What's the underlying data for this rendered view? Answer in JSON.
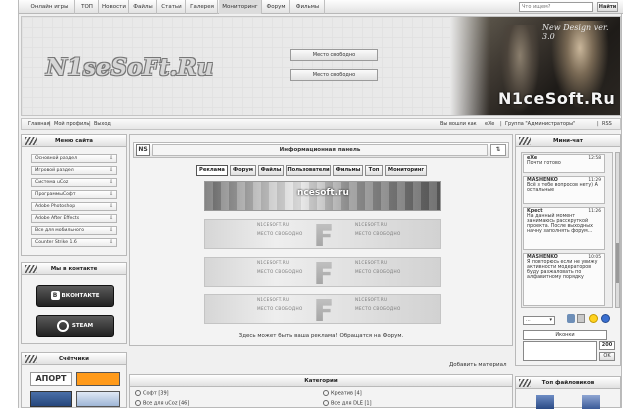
{
  "topnav": {
    "items": [
      "Онлайн игры",
      "ТОП",
      "Новости",
      "Файлы",
      "Статьи",
      "Галерея",
      "Мониторинг",
      "Форум",
      "Фильмы"
    ],
    "search_placeholder": "Что ищем?",
    "search_button": "Найти"
  },
  "header": {
    "logo": "N1seSoFt.Ru",
    "version": "New Design ver. 3.0",
    "brand": "N1ceSoft.Ru",
    "ads": [
      "Место свободно",
      "Место свободно"
    ]
  },
  "subbar": {
    "links": [
      "Главная",
      "Мой профиль",
      "Выход"
    ],
    "logged_in": "Вы вошли как",
    "user": "eXe",
    "group": "Группа \"Администраторы\"",
    "rss": "RSS"
  },
  "site_menu": {
    "title": "Меню сайта",
    "items": [
      "Основной раздел",
      "Игровой раздел",
      "Система uCoz",
      "ПрограммыСофт",
      "Adobe Photoshop",
      "Adobe After Effects",
      "Все для мобильного",
      "Counter Strike 1.6"
    ]
  },
  "social": {
    "title": "Мы в контакте",
    "vk": "ВКОНТАКТЕ",
    "steam": "STEAM"
  },
  "counters": {
    "title": "Счётчики",
    "aport": "АПОРТ"
  },
  "info_panel": {
    "title": "Информационная панель",
    "logo": "NS",
    "tabs": [
      "Реклама",
      "Форум",
      "Файлы",
      "Пользователи",
      "Фильмы",
      "Топ",
      "Мониторинг"
    ],
    "banner_site": "ncesoft.ru",
    "banner_text_top": "N1CESOFT.RU",
    "banner_text_free": "МЕСТО СВОБОДНО",
    "ad_note": "Здесь может быть ваша реклама! Обращатся на Форум.",
    "add_material": "Добавить материал"
  },
  "categories": {
    "title": "Категории",
    "left": [
      "Софт [39]",
      "Все для uCoz [46]"
    ],
    "right": [
      "Креатив [4]",
      "Все для DLE [1]"
    ]
  },
  "mini_chat": {
    "title": "Мини-чат",
    "messages": [
      {
        "nick": "eXe",
        "time": "12:58",
        "text": "Почти готово"
      },
      {
        "nick": "MASHENKO",
        "time": "11:29",
        "text": "Всё з тебе вопросов нету) А остальные"
      },
      {
        "nick": "Kpect",
        "time": "11:26",
        "text": "На данный момент занимаюсь расскруткой проекта. После выходных начну заполнять форум..."
      },
      {
        "nick": "MASHENKO",
        "time": "10:05",
        "text": "Я повторюсь если не увижу активности модераторов буду разжаловать по алфавитному порядку"
      }
    ],
    "select_value": "...",
    "counter": "200",
    "ok": "OK",
    "name_value": "Иконки"
  },
  "top_files": {
    "title": "Топ файловиков"
  }
}
